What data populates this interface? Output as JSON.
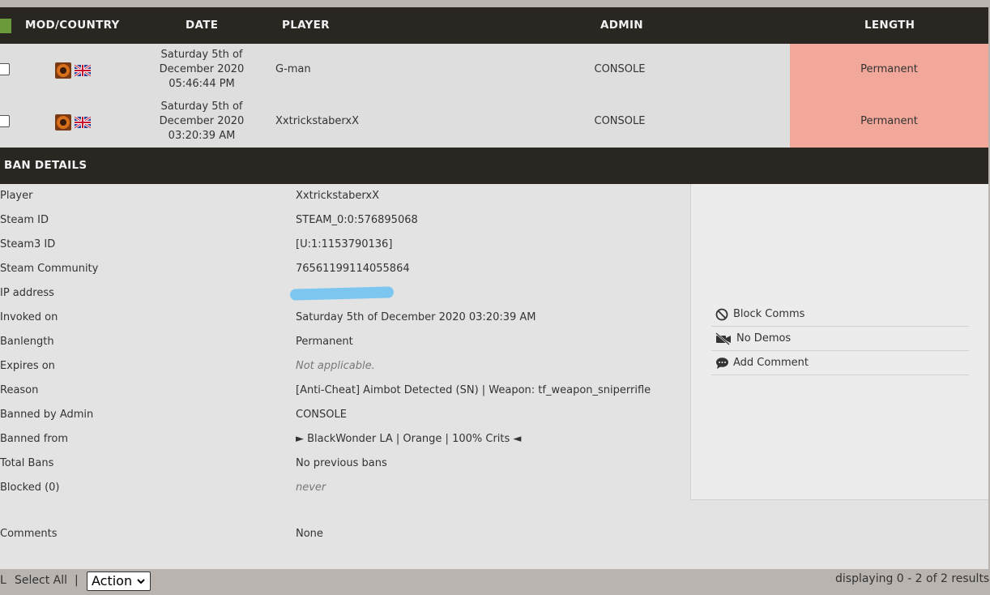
{
  "table": {
    "headers": {
      "mod_country": "MOD/COUNTRY",
      "date": "DATE",
      "player": "PLAYER",
      "admin": "ADMIN",
      "length": "LENGTH"
    },
    "rows": [
      {
        "date_line1": "Saturday 5th of",
        "date_line2": "December 2020",
        "date_line3": "05:46:44 PM",
        "player": "G-man",
        "admin": "CONSOLE",
        "length": "Permanent",
        "mod_icon": "tf2-icon",
        "flag_icon": "uk-flag-icon"
      },
      {
        "date_line1": "Saturday 5th of",
        "date_line2": "December 2020",
        "date_line3": "03:20:39 AM",
        "player": "XxtrickstaberxX",
        "admin": "CONSOLE",
        "length": "Permanent",
        "mod_icon": "tf2-icon",
        "flag_icon": "uk-flag-icon"
      }
    ],
    "length_color": "#f2a79b"
  },
  "ban_details": {
    "title": "BAN DETAILS",
    "fields": [
      {
        "label": "Player",
        "value": "XxtrickstaberxX"
      },
      {
        "label": "Steam ID",
        "value": "STEAM_0:0:576895068"
      },
      {
        "label": "Steam3 ID",
        "value": "[U:1:1153790136]"
      },
      {
        "label": "Steam Community",
        "value": "76561199114055864"
      },
      {
        "label": "IP address",
        "value": ""
      },
      {
        "label": "Invoked on",
        "value": "Saturday 5th of December 2020 03:20:39 AM"
      },
      {
        "label": "Banlength",
        "value": "Permanent"
      },
      {
        "label": "Expires on",
        "value": "Not applicable."
      },
      {
        "label": "Reason",
        "value": "[Anti-Cheat] Aimbot Detected (SN) | Weapon: tf_weapon_sniperrifle"
      },
      {
        "label": "Banned by Admin",
        "value": "CONSOLE"
      },
      {
        "label": "Banned from",
        "value": "► BlackWonder LA | Orange | 100% Crits ◄"
      },
      {
        "label": "Total Bans",
        "value": "No previous bans"
      },
      {
        "label": "Blocked (0)",
        "value": "never"
      },
      {
        "label": "Comments",
        "value": "None"
      }
    ],
    "actions": [
      {
        "label": "Block Comms",
        "icon": "block-icon"
      },
      {
        "label": "No Demos",
        "icon": "no-video-icon"
      },
      {
        "label": "Add Comment",
        "icon": "comment-icon"
      }
    ]
  },
  "footer": {
    "prefix": "L",
    "select_all": "Select All",
    "separator": "|",
    "action_select": "Action",
    "results": "displaying 0 - 2 of 2 results"
  },
  "colors": {
    "header_bg": "#2a2723",
    "row_bg": "#dedede",
    "accent_green": "#6a9a3a",
    "redaction": "#7dc6f0"
  }
}
